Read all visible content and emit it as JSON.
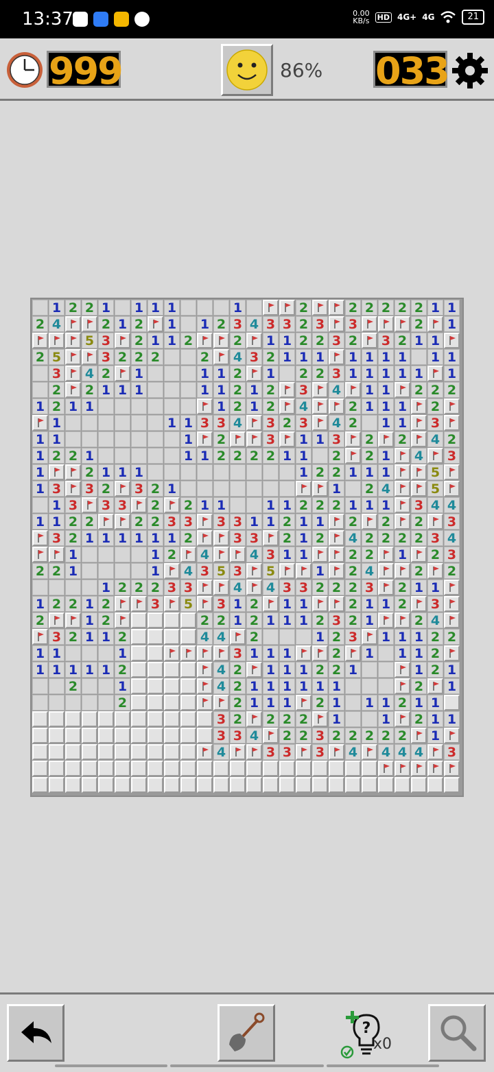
{
  "status_bar": {
    "time": "13:37",
    "net_speed_value": "0.00",
    "net_speed_unit": "KB/s",
    "hd_label": "HD",
    "net1": "4G+",
    "net2": "4G",
    "battery": "21"
  },
  "game": {
    "timer": "999",
    "mines_left": "033",
    "progress": "86%"
  },
  "board": {
    "columns": 26,
    "rows": 30,
    "legend": "char codes: 0 = opened empty, 1-5 = opened number, F = flagged, H = unopened",
    "cells": [
      "01221011100010FF2FF2222211",
      "24FF212F1012343323F3FFF2F1",
      "FFF53F2112FF2F112232F3211F",
      "25FF3222002F432111F1111011",
      "03F42F1000112F1022311111F1",
      "02F211100011212F3F4F11F222",
      "1211000000F1212F4FF2111F2F",
      "F100000011334F323F42011F3F",
      "1100000001F2FF3F113F2F2F42",
      "1221000001122221102F21F4F3",
      "1FF2111000000000122111FF5F",
      "13F32F3210000000FF1024FF5F",
      "013F33F2F2110011222111F344",
      "1122FF2233F3311211F2F2F2F3",
      "F321111112FF33F212F4222234",
      "FF1000012F4FF4311FF22F1F23",
      "22100001F4353F5FF1F24FF2F2",
      "0000122233FF4F4332223F211F",
      "12212FF3F5F312F11FF2112F3F",
      "2FF12FHHHH22121112321FF24F",
      "F32112HHHH44F2000123F11122",
      "110001HHFFFF3111FF2F10112F",
      "111112HHHHF42F11122100F121",
      "002001HHHHF42111111000F2F1",
      "000002HHHHFF2111F21011211",
      "HHHHHHHHHHH32F222F1001F211",
      "HHHHHHHHHHH334F22322222F1F",
      "HHHHHHHHHHF4FF33F3F4F444F3",
      "HHHHHHHHHHHHHHHHHHHHHFFFFF",
      "HHHHHHHHHHHHHHHHHHHHHHHHHH"
    ]
  },
  "tools": {
    "undo": "undo",
    "dig": "dig",
    "hint_count": "x0",
    "zoom": "zoom"
  },
  "icons": {
    "clock": "clock-icon",
    "smiley": "smiley-face-icon",
    "settings": "gear-icon",
    "undo": "undo-arrow-icon",
    "shovel": "shovel-icon",
    "hint": "lightbulb-hint-icon",
    "zoom": "magnifier-icon",
    "flag": "flag-icon"
  },
  "colors": {
    "counter_digits": "#e8a317",
    "num1": "#1a2bb5",
    "num2": "#2a8a2a",
    "num3": "#cc2a2a",
    "num4": "#1f8a9a",
    "num5": "#8a8a10",
    "flag": "#d23a3a"
  }
}
